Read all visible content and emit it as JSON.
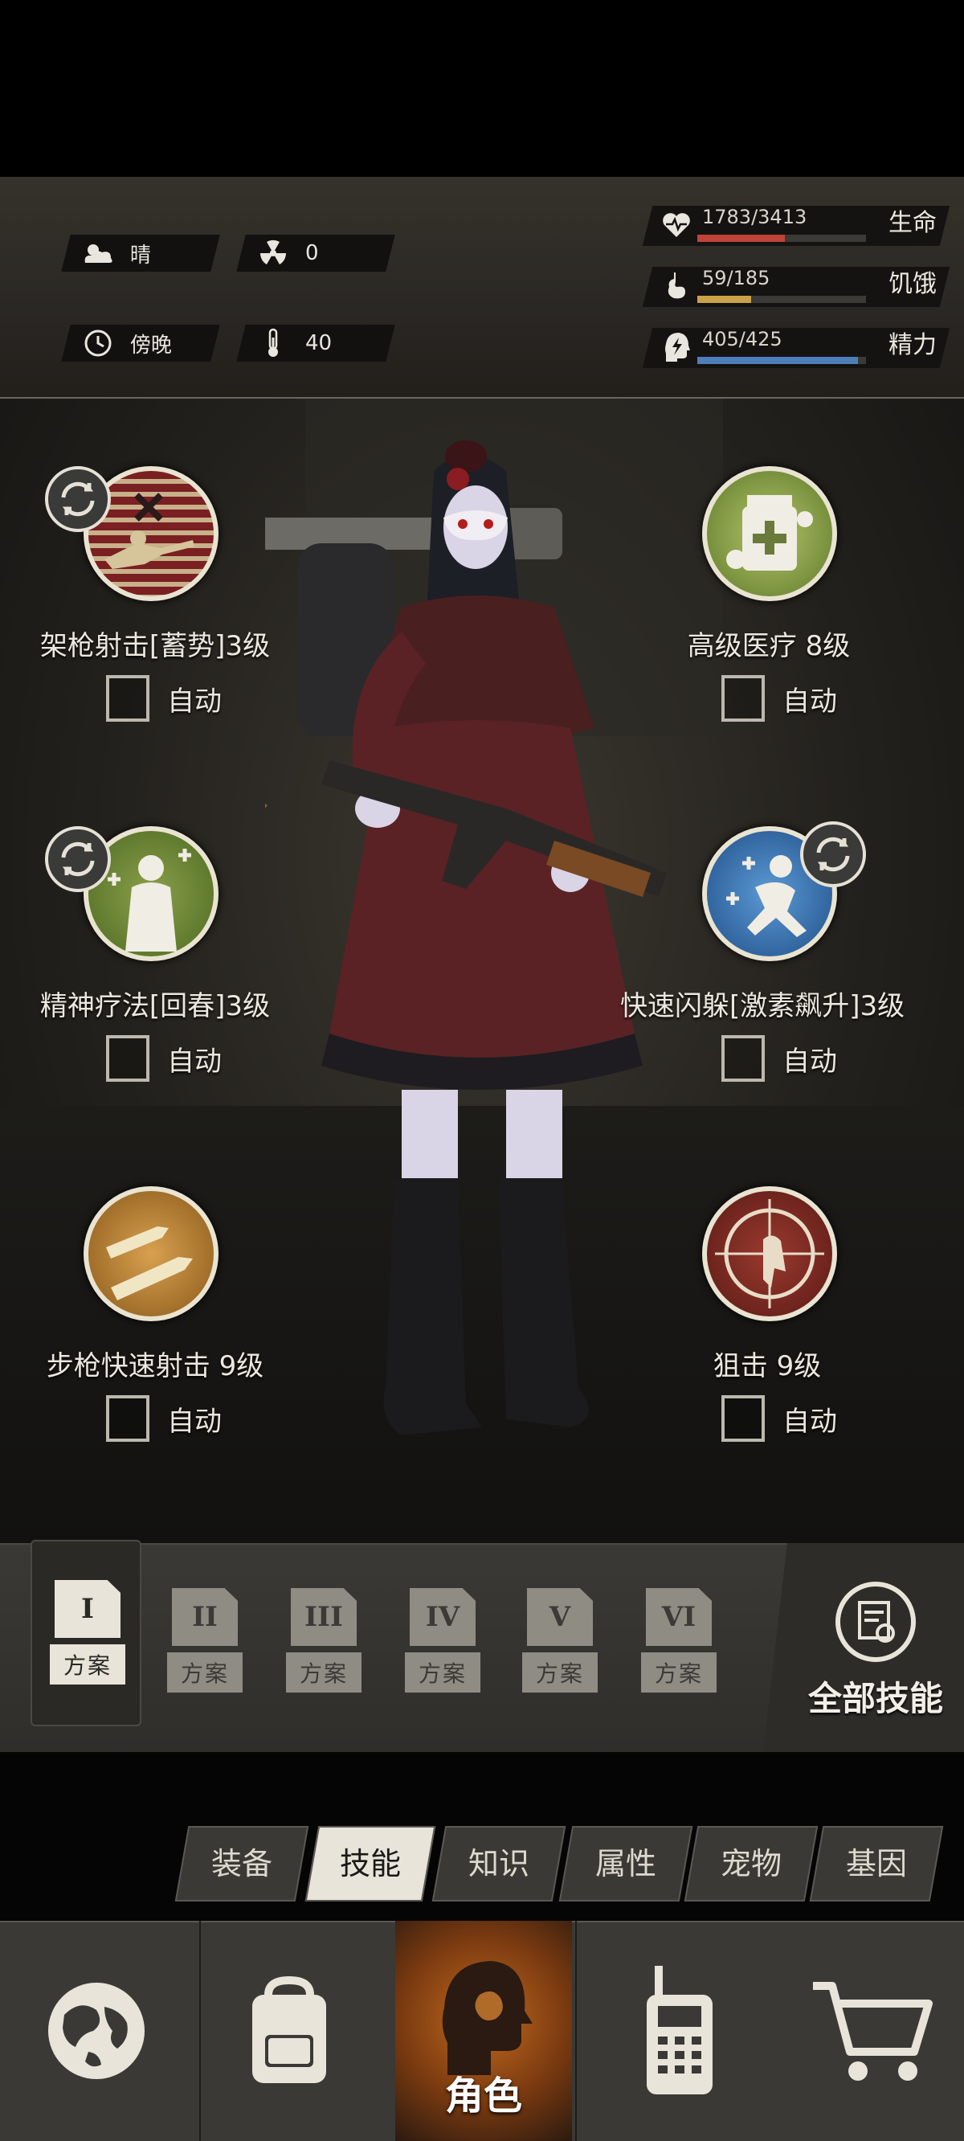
{
  "header": {
    "weather": "晴",
    "radiation": "0",
    "time_of_day": "傍晚",
    "temperature": "40",
    "stats": [
      {
        "label": "生命",
        "value": "1783/3413",
        "fraction": 0.52,
        "color": "#c0433a",
        "icon": "heart-pulse-icon"
      },
      {
        "label": "饥饿",
        "value": "59/185",
        "fraction": 0.32,
        "color": "#c9a24a",
        "icon": "stomach-icon"
      },
      {
        "label": "精力",
        "value": "405/425",
        "fraction": 0.95,
        "color": "#4f7fb8",
        "icon": "head-energy-icon"
      }
    ]
  },
  "skills": [
    {
      "name": "架枪射击[蓄势]3级",
      "auto_label": "自动",
      "auto": false,
      "icon": "sniper-prone-icon",
      "swap": true
    },
    {
      "name": "高级医疗 8级",
      "auto_label": "自动",
      "auto": false,
      "icon": "medkit-icon",
      "swap": false
    },
    {
      "name": "精神疗法[回春]3级",
      "auto_label": "自动",
      "auto": false,
      "icon": "mind-heal-icon",
      "swap": true
    },
    {
      "name": "快速闪躲[激素飙升]3级",
      "auto_label": "自动",
      "auto": false,
      "icon": "dodge-icon",
      "swap": true
    },
    {
      "name": "步枪快速射击 9级",
      "auto_label": "自动",
      "auto": false,
      "icon": "rifle-bullets-icon",
      "swap": false
    },
    {
      "name": "狙击 9级",
      "auto_label": "自动",
      "auto": false,
      "icon": "crosshair-icon",
      "swap": false
    }
  ],
  "plans": [
    {
      "numeral": "I",
      "label": "方案",
      "active": true
    },
    {
      "numeral": "II",
      "label": "方案",
      "active": false
    },
    {
      "numeral": "III",
      "label": "方案",
      "active": false
    },
    {
      "numeral": "IV",
      "label": "方案",
      "active": false
    },
    {
      "numeral": "V",
      "label": "方案",
      "active": false
    },
    {
      "numeral": "VI",
      "label": "方案",
      "active": false
    }
  ],
  "all_skills_label": "全部技能",
  "tabs": [
    {
      "label": "装备",
      "active": false
    },
    {
      "label": "技能",
      "active": true
    },
    {
      "label": "知识",
      "active": false
    },
    {
      "label": "属性",
      "active": false
    },
    {
      "label": "宠物",
      "active": false
    },
    {
      "label": "基因",
      "active": false
    }
  ],
  "nav": [
    {
      "icon": "globe-icon",
      "label": ""
    },
    {
      "icon": "backpack-icon",
      "label": ""
    },
    {
      "icon": "character-head-icon",
      "label": "角色",
      "active": true
    },
    {
      "icon": "walkie-talkie-icon",
      "label": ""
    },
    {
      "icon": "cart-icon",
      "label": ""
    }
  ]
}
